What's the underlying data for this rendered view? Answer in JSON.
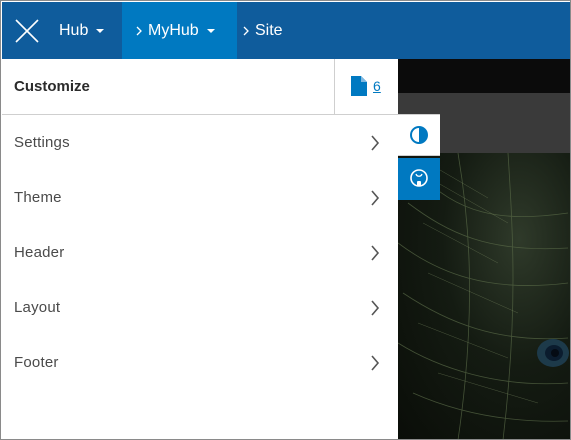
{
  "topbar": {
    "close_icon": "close-icon",
    "hub_label": "Hub",
    "myhub_label": "MyHub",
    "site_label": "Site",
    "colors": {
      "bar": "#0f5c9c",
      "active_crumb": "#0079c1"
    }
  },
  "panel": {
    "title": "Customize",
    "doc_count": "6",
    "doc_icon": "document-icon"
  },
  "menu": {
    "items": [
      {
        "label": "Settings"
      },
      {
        "label": "Theme"
      },
      {
        "label": "Header"
      },
      {
        "label": "Layout"
      },
      {
        "label": "Footer"
      }
    ]
  },
  "tools": {
    "contrast_icon": "contrast-icon",
    "brush_icon": "paint-brush-icon"
  },
  "accent": "#0079c1"
}
